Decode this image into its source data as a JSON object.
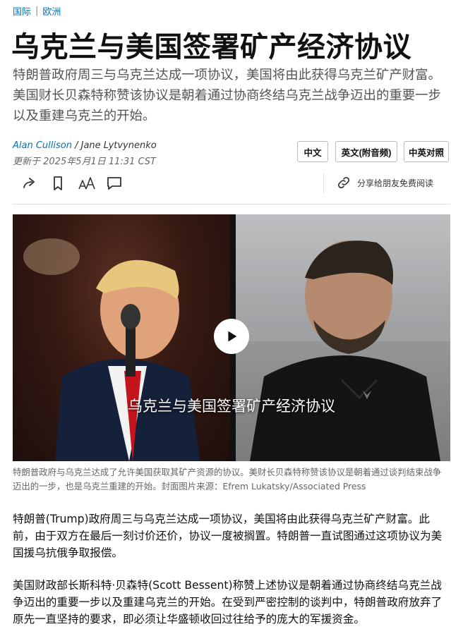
{
  "breadcrumb": {
    "section": "国际",
    "subsection": "欧洲"
  },
  "headline": "乌克兰与美国签署矿产经济协议",
  "dek": "特朗普政府周三与乌克兰达成一项协议，美国将由此获得乌克兰矿产财富。美国财长贝森特称赞该协议是朝着通过协商终结乌克兰战争迈出的重要一步以及重建乌克兰的开始。",
  "byline": {
    "author1": "Alan Cullison",
    "separator": " / ",
    "author2": "Jane Lytvynenko",
    "updated": "更新于 2025年5月1日 11:31 CST"
  },
  "language_buttons": {
    "zh": "中文",
    "en": "英文(附音频)",
    "both": "中英对照"
  },
  "toolbar": {
    "share_icon": "share-arrow-icon",
    "bookmark_icon": "bookmark-icon",
    "textsize_icon": "text-size-icon",
    "comment_icon": "comment-icon",
    "gift_label": "分享给朋友免费阅读"
  },
  "video": {
    "title": "乌克兰与美国签署矿产经济协议",
    "play_icon": "play-icon"
  },
  "caption": "特朗普政府与乌克兰达成了允许美国获取其矿产资源的协议。美财长贝森特称赞该协议是朝着通过谈判结束战争迈出的一步，也是乌克兰重建的开始。封面图片来源：Efrem Lukatsky/Associated Press",
  "body": {
    "p1": "特朗普(Trump)政府周三与乌克兰达成一项协议，美国将由此获得乌克兰矿产财富。此前，由于双方在最后一刻讨价还价，协议一度被搁置。特朗普一直试图通过这项协议为美国援乌抗俄争取报偿。",
    "p2": "美国财政部长斯科特·贝森特(Scott Bessent)称赞上述协议是朝着通过协商终结乌克兰战争迈出的重要一步以及重建乌克兰的开始。在受到严密控制的谈判中，特朗普政府放弃了原先一直坚持的要求，即必须让华盛顿收回过往给予的庞大的军援资金。"
  }
}
